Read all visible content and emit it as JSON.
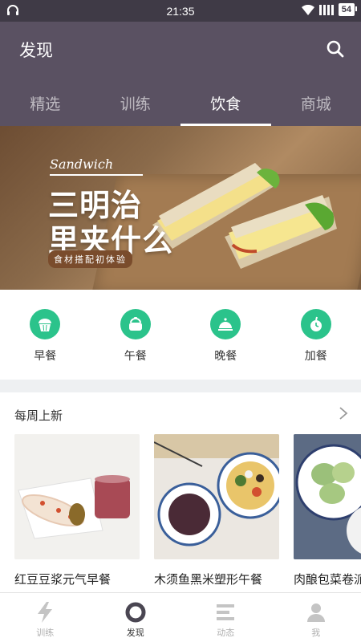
{
  "status_bar": {
    "time": "21:35",
    "battery": "54"
  },
  "header": {
    "title": "发现"
  },
  "tabs": [
    {
      "label": "精选",
      "active": false
    },
    {
      "label": "训练",
      "active": false
    },
    {
      "label": "饮食",
      "active": true
    },
    {
      "label": "商城",
      "active": false
    }
  ],
  "banner": {
    "script_text": "Sandwich",
    "title_line1": "三明治",
    "title_line2": "里夹什么",
    "tag": "食材搭配初体验"
  },
  "categories": [
    {
      "label": "早餐",
      "icon": "muffin-icon"
    },
    {
      "label": "午餐",
      "icon": "lunch-bowl-icon"
    },
    {
      "label": "晚餐",
      "icon": "cloche-icon"
    },
    {
      "label": "加餐",
      "icon": "apple-icon"
    }
  ],
  "weekly": {
    "title": "每周上新",
    "cards": [
      {
        "name": "红豆豆浆元气早餐"
      },
      {
        "name": "木须鱼黑米塑形午餐"
      },
      {
        "name": "肉酿包菜卷派"
      }
    ]
  },
  "bottom_nav": [
    {
      "label": "训练",
      "icon": "lightning-icon",
      "active": false
    },
    {
      "label": "发现",
      "icon": "discover-ring-icon",
      "active": true
    },
    {
      "label": "动态",
      "icon": "feed-lines-icon",
      "active": false
    },
    {
      "label": "我",
      "icon": "person-icon",
      "active": false
    }
  ],
  "colors": {
    "header": "#5a5162",
    "accent": "#2bc38b",
    "status_bar": "#3f3a46"
  }
}
